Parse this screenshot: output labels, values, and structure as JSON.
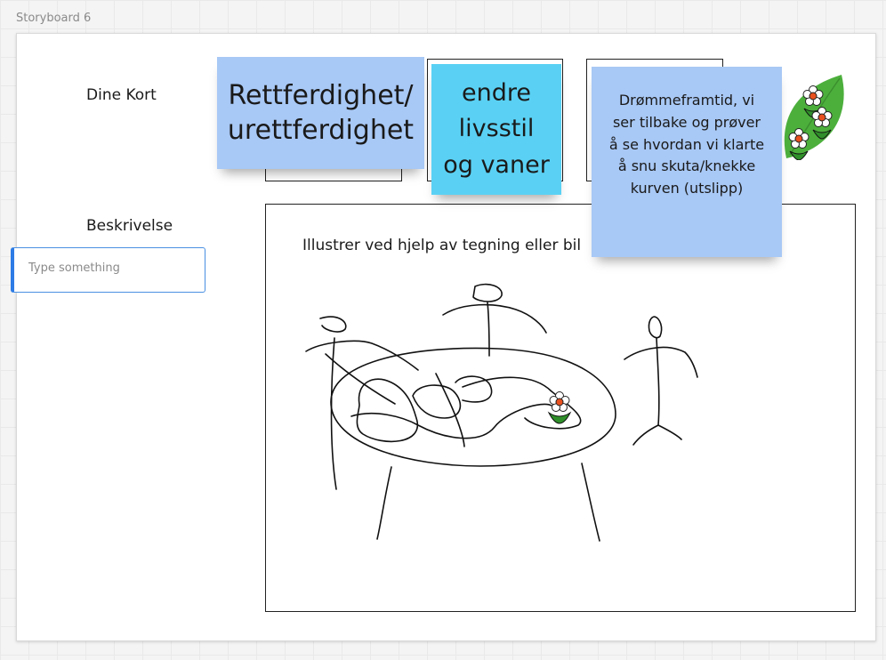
{
  "frame": {
    "title": "Storyboard 6"
  },
  "labels": {
    "dine_kort": "Dine Kort",
    "beskrivelse": "Beskrivelse"
  },
  "input": {
    "placeholder": "Type something",
    "value": ""
  },
  "cards": [
    {
      "text": "Rettferdighet/ urettferdighet",
      "color": "#a8c8f5"
    },
    {
      "text": "endre livsstil og vaner",
      "color": "#5ad1f4"
    },
    {
      "text": "Drømmeframtid, vi ser tilbake og prøver å se hvordan vi klarte å snu skuta/knekke kurven (utslipp)",
      "color": "#a8c8f5"
    }
  ],
  "drawing": {
    "instruction": "Illustrer ved hjelp av tegning eller bil"
  },
  "icons": {
    "sticker": "flower-leaf-sticker-icon",
    "small": "flower-icon"
  }
}
